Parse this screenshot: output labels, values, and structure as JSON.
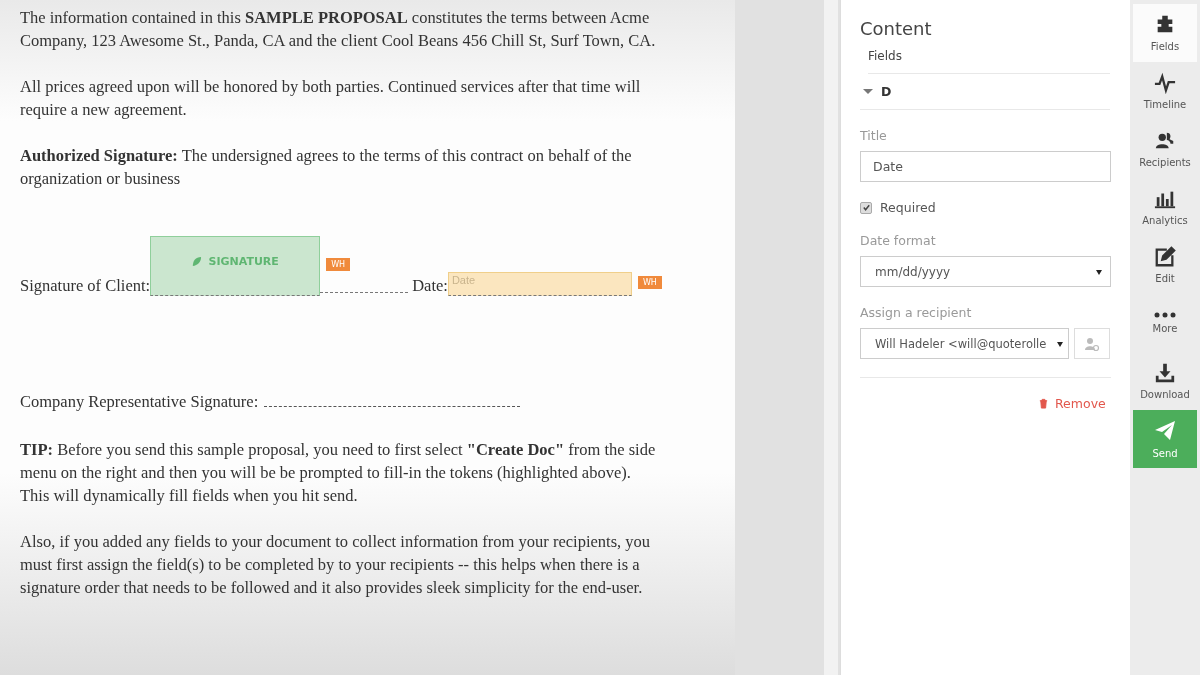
{
  "document": {
    "intro": [
      "The information contained in this **SAMPLE PROPOSAL** constitutes the terms between Acme Company, 123 Awesome St., Panda, CA and the client Cool Beans 456 Chill St, Surf Town, CA.",
      "All prices agreed upon will be honored by both parties. Continued services after that time will require a new agreement.",
      "**Authorized Signature:** The undersigned agrees to the terms of this contract on behalf of the organization or business"
    ],
    "signature_row": {
      "client_label": "Signature of Client:",
      "signature_field": {
        "label": "SIGNATURE",
        "tag": "WH"
      },
      "date_label": "Date:",
      "date_field": {
        "placeholder": "Date",
        "tag": "WH"
      }
    },
    "company_signature": "Company Representative Signature:",
    "notes": [
      "**TIP:** Before you send this sample proposal, you need to first select **\"Create Doc\"** from the side menu on the right and then you will be be prompted to fill-in the tokens (highlighted above). This will dynamically fill fields when you hit send.",
      "Also, if you added any fields to your document to collect information from your recipients, you must first assign the field(s) to be completed by to your recipients -- this helps when there is a signature order that needs to be followed and it also provides sleek simplicity for the end-user."
    ]
  },
  "panel": {
    "title": "Content",
    "subtitle": "Fields",
    "section": {
      "title": "D",
      "expanded": true
    },
    "title_label": "Title",
    "title_value": "Date",
    "required": {
      "label": "Required",
      "checked": true
    },
    "date_format": {
      "label": "Date format",
      "value": "mm/dd/yyyy"
    },
    "recipient": {
      "label": "Assign a recipient",
      "value": "Will Hadeler <will@quoterolle"
    },
    "remove": "Remove"
  },
  "rail": [
    {
      "kind": "fields",
      "label": "Fields",
      "selected": true
    },
    {
      "kind": "timeline",
      "label": "Timeline",
      "selected": false
    },
    {
      "kind": "recipients",
      "label": "Recipients",
      "selected": false
    },
    {
      "kind": "analytics",
      "label": "Analytics",
      "selected": false
    },
    {
      "kind": "edit",
      "label": "Edit",
      "selected": false
    },
    {
      "kind": "more",
      "label": "More",
      "selected": false
    },
    {
      "kind": "download",
      "label": "Download",
      "selected": false
    }
  ],
  "send_button": {
    "label": "Send"
  }
}
